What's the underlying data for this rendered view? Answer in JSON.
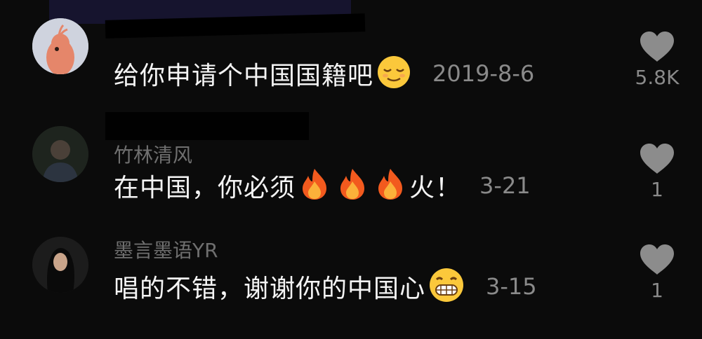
{
  "comments": [
    {
      "username": "",
      "text": "给你申请个中国国籍吧",
      "emoji": "relieved-face",
      "date": "2019-8-6",
      "likes": "5.8K"
    },
    {
      "username": "竹林清风",
      "text_before": "在中国，你必须",
      "emoji": "fire",
      "text_after": "火！",
      "date": "3-21",
      "likes": "1"
    },
    {
      "username": "墨言墨语YR",
      "text": "唱的不错，谢谢你的中国心",
      "emoji": "grinning-face",
      "date": "3-15",
      "likes": "1"
    }
  ],
  "colors": {
    "background": "#0b0b0b",
    "comment_text": "#f4f4f4",
    "muted_text": "#8a8a8a",
    "like_icon": "#8c8c8c"
  }
}
